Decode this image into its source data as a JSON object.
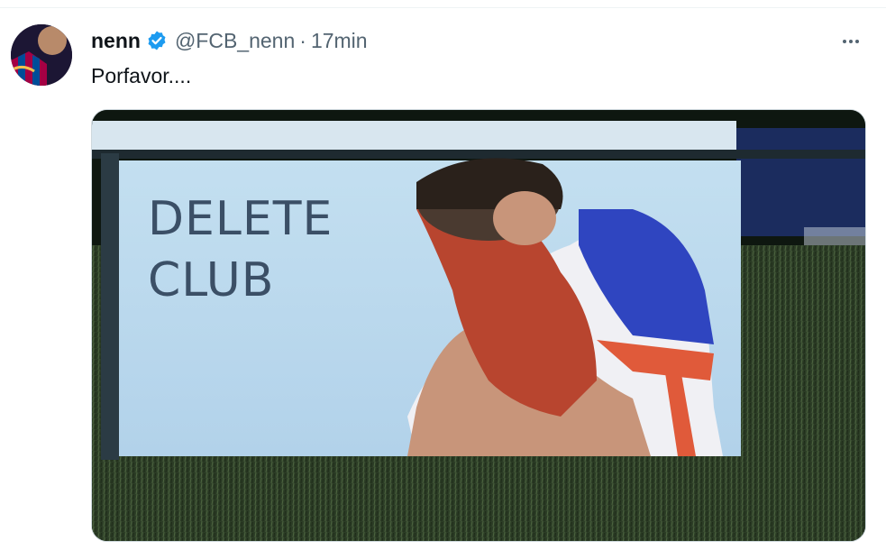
{
  "tweet": {
    "author_name": "nenn",
    "handle": "@FCB_nenn",
    "separator": "·",
    "time": "17min",
    "text": "Porfavor....",
    "verified_icon": "verified-badge-icon",
    "more_icon": "more-options-icon"
  },
  "media": {
    "banner_line1": "DELETE",
    "banner_line2": "CLUB"
  },
  "colors": {
    "verified": "#1d9bf0",
    "secondary_text": "#536471",
    "primary_text": "#0f1419"
  }
}
